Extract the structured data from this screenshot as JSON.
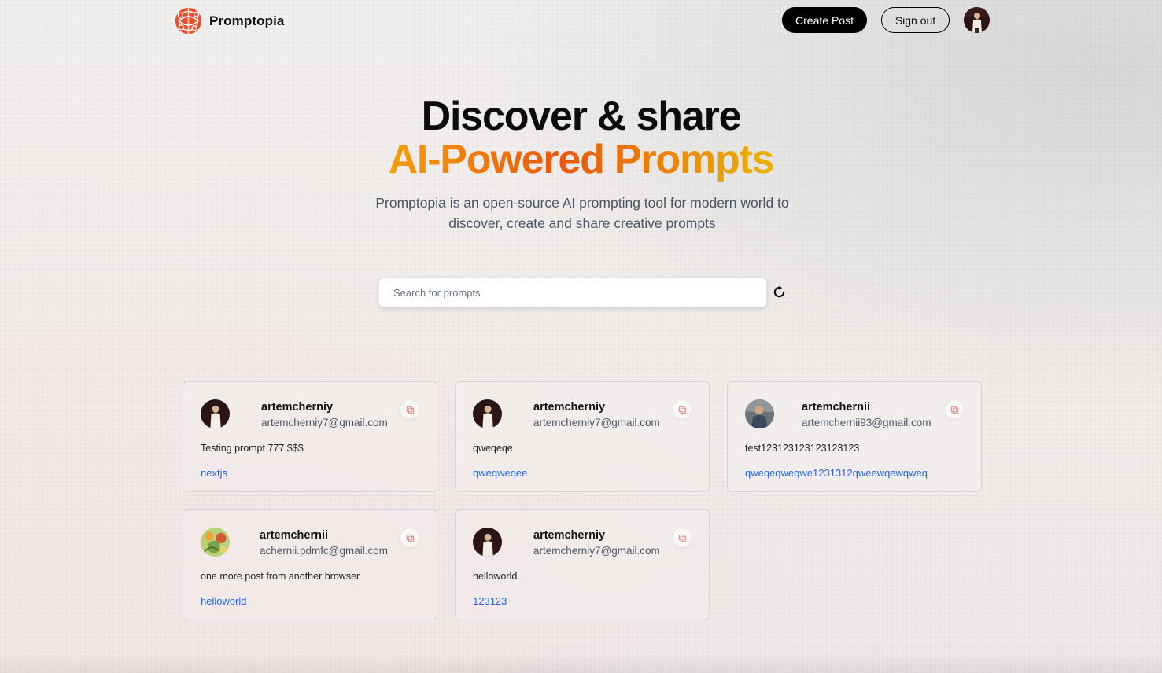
{
  "nav": {
    "brand": "Promptopia",
    "create_post_label": "Create Post",
    "sign_out_label": "Sign out"
  },
  "hero": {
    "title_line1": "Discover & share",
    "title_line2": "AI-Powered Prompts",
    "subtitle": "Promptopia is an open-source AI prompting tool for modern world to discover, create and share creative prompts"
  },
  "search": {
    "placeholder": "Search for prompts",
    "value": ""
  },
  "colors": {
    "accent_orange": "#ea580c",
    "tag_blue": "#2563eb",
    "button_black": "#000000"
  },
  "icons": {
    "logo": "globe-network-icon",
    "refresh": "refresh-icon",
    "copy": "copy-icon"
  },
  "posts": [
    {
      "username": "artemcherniy",
      "email": "artemcherniy7@gmail.com",
      "prompt": "Testing prompt 777 $$$",
      "tag": "nextjs",
      "avatar": "person-dark"
    },
    {
      "username": "artemcherniy",
      "email": "artemcherniy7@gmail.com",
      "prompt": "qweqeqe",
      "tag": "qweqweqee",
      "avatar": "person-dark"
    },
    {
      "username": "artemchernii",
      "email": "artemchernii93@gmail.com",
      "prompt": "test123123123123123123",
      "tag": "qweqeqweqwe1231312qweewqewqweq",
      "avatar": "person-gray"
    },
    {
      "username": "artemchernii",
      "email": "achernii.pdmfc@gmail.com",
      "prompt": "one more post from another browser",
      "tag": "helloworld",
      "avatar": "illustration-green"
    },
    {
      "username": "artemcherniy",
      "email": "artemcherniy7@gmail.com",
      "prompt": "helloworld",
      "tag": "123123",
      "avatar": "person-dark"
    }
  ]
}
